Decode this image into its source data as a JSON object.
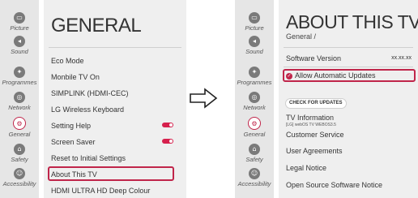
{
  "categories": [
    {
      "label": "Picture",
      "icon": "picture-icon",
      "glyph": "▭"
    },
    {
      "label": "Sound",
      "icon": "sound-icon",
      "glyph": "◂"
    },
    {
      "label": "Programmes",
      "icon": "programmes-icon",
      "glyph": "✦"
    },
    {
      "label": "Network",
      "icon": "network-icon",
      "glyph": "◎"
    },
    {
      "label": "General",
      "icon": "general-icon",
      "glyph": "⚙"
    },
    {
      "label": "Safety",
      "icon": "safety-icon",
      "glyph": "⌂"
    },
    {
      "label": "Accessibility",
      "icon": "accessibility-icon",
      "glyph": "☺"
    }
  ],
  "left": {
    "title": "GENERAL",
    "items": [
      "Eco Mode",
      "Monbile TV On",
      "SIMPLINK (HDMI-CEC)",
      "LG Wireless Keyboard",
      "Setting Help",
      "Screen Saver",
      "Reset to Initial Settings",
      "About This TV",
      "HDMI ULTRA HD Deep Colour"
    ],
    "toggles_on": [
      "Setting Help",
      "Screen Saver"
    ],
    "selected": "About This TV"
  },
  "right": {
    "title": "ABOUT THIS TV",
    "subtitle": "General /",
    "software_version_label": "Software Version",
    "software_version_value": "xx.xx.xx",
    "auto_update_label": "Allow Automatic Updates",
    "auto_update_checked": true,
    "check_button": "CHECK FOR UPDATES",
    "tv_info_label": "TV Information",
    "tv_info_sub": "[LG] webOS TV WEBOS3.5",
    "items": [
      "Customer Service",
      "User Agreements",
      "Legal Notice",
      "Open Source Software Notice"
    ]
  },
  "colors": {
    "accent": "#c0254a",
    "toggle": "#d6204d",
    "rail": "#e6e6e6",
    "content": "#efefef"
  },
  "arrow_icon": "right-arrow-icon"
}
